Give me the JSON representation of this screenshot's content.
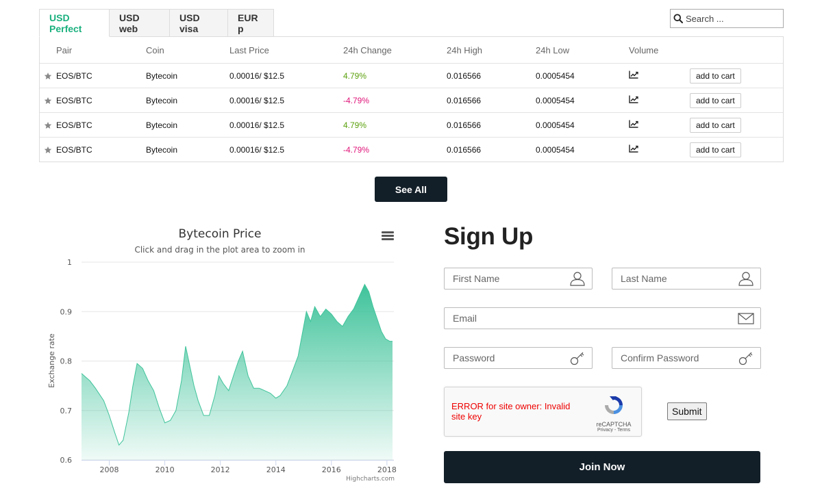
{
  "market": {
    "tabs": [
      {
        "label": "USD Perfect",
        "active": true
      },
      {
        "label": "USD web",
        "active": false
      },
      {
        "label": "USD visa",
        "active": false
      },
      {
        "label": "EUR p",
        "active": false
      }
    ],
    "search_placeholder": "Search ...",
    "columns": {
      "pair": "Pair",
      "coin": "Coin",
      "last_price": "Last Price",
      "change": "24h Change",
      "high": "24h High",
      "low": "24h Low",
      "volume": "Volume"
    },
    "rows": [
      {
        "pair": "EOS/BTC",
        "coin": "Bytecoin",
        "last_price": "0.00016/ $12.5",
        "change": "4.79%",
        "direction": "up",
        "high": "0.016566",
        "low": "0.0005454",
        "cart": "add to cart"
      },
      {
        "pair": "EOS/BTC",
        "coin": "Bytecoin",
        "last_price": "0.00016/ $12.5",
        "change": "-4.79%",
        "direction": "down",
        "high": "0.016566",
        "low": "0.0005454",
        "cart": "add to cart"
      },
      {
        "pair": "EOS/BTC",
        "coin": "Bytecoin",
        "last_price": "0.00016/ $12.5",
        "change": "4.79%",
        "direction": "up",
        "high": "0.016566",
        "low": "0.0005454",
        "cart": "add to cart"
      },
      {
        "pair": "EOS/BTC",
        "coin": "Bytecoin",
        "last_price": "0.00016/ $12.5",
        "change": "-4.79%",
        "direction": "down",
        "high": "0.016566",
        "low": "0.0005454",
        "cart": "add to cart"
      }
    ],
    "see_all_label": "See All"
  },
  "chart_data": {
    "type": "area",
    "title": "Bytecoin Price",
    "subtitle": "Click and drag in the plot area to zoom in",
    "ylabel": "Exchange rate",
    "xlabel": "",
    "credit": "Highcharts.com",
    "xlim": [
      2007.0,
      2018.25
    ],
    "ylim": [
      0.6,
      1.0
    ],
    "x_ticks": [
      "2008",
      "2010",
      "2012",
      "2014",
      "2016",
      "2018"
    ],
    "y_ticks": [
      "0.6",
      "0.7",
      "0.8",
      "0.9",
      "1"
    ],
    "grid": true,
    "series": [
      {
        "x": [
          2007.0,
          2007.3,
          2007.5,
          2007.8,
          2008.0,
          2008.2,
          2008.35,
          2008.5,
          2008.7,
          2008.85,
          2009.0,
          2009.2,
          2009.4,
          2009.6,
          2009.8,
          2010.0,
          2010.2,
          2010.4,
          2010.6,
          2010.75,
          2010.9,
          2011.05,
          2011.2,
          2011.4,
          2011.6,
          2011.8,
          2011.95,
          2012.1,
          2012.3,
          2012.5,
          2012.65,
          2012.8,
          2013.0,
          2013.2,
          2013.4,
          2013.6,
          2013.8,
          2014.0,
          2014.15,
          2014.4,
          2014.6,
          2014.8,
          2015.0,
          2015.1,
          2015.25,
          2015.4,
          2015.6,
          2015.8,
          2016.0,
          2016.2,
          2016.4,
          2016.6,
          2016.8,
          2017.0,
          2017.2,
          2017.35,
          2017.5,
          2017.65,
          2017.8,
          2017.95,
          2018.1,
          2018.2
        ],
        "y": [
          0.775,
          0.76,
          0.745,
          0.72,
          0.69,
          0.655,
          0.63,
          0.64,
          0.695,
          0.75,
          0.795,
          0.785,
          0.76,
          0.74,
          0.705,
          0.675,
          0.68,
          0.7,
          0.76,
          0.83,
          0.79,
          0.75,
          0.72,
          0.69,
          0.69,
          0.73,
          0.77,
          0.755,
          0.74,
          0.775,
          0.8,
          0.82,
          0.77,
          0.745,
          0.745,
          0.74,
          0.735,
          0.725,
          0.73,
          0.75,
          0.78,
          0.81,
          0.87,
          0.9,
          0.88,
          0.91,
          0.89,
          0.905,
          0.895,
          0.88,
          0.87,
          0.89,
          0.905,
          0.93,
          0.955,
          0.94,
          0.91,
          0.885,
          0.86,
          0.845,
          0.84,
          0.84
        ]
      }
    ]
  },
  "signup": {
    "title": "Sign Up",
    "first_name_placeholder": "First Name",
    "last_name_placeholder": "Last Name",
    "email_placeholder": "Email",
    "password_placeholder": "Password",
    "confirm_password_placeholder": "Confirm Password",
    "recaptcha_error": "ERROR for site owner: Invalid site key",
    "recaptcha_brand": "reCAPTCHA",
    "recaptcha_terms": "Privacy - Terms",
    "submit_label": "Submit",
    "join_label": "Join Now"
  },
  "colors": {
    "accent_green": "#19b07e",
    "positive": "#5aa00c",
    "negative": "#e0157a",
    "dark_button": "#131f28",
    "area_fill": "#3fc39a"
  },
  "icons": {
    "search": "search-icon",
    "star": "star-icon",
    "volume": "trend-chart-icon",
    "menu": "hamburger-menu-icon",
    "user": "user-icon",
    "email": "envelope-icon",
    "password": "key-icon",
    "recaptcha": "recaptcha-logo"
  }
}
